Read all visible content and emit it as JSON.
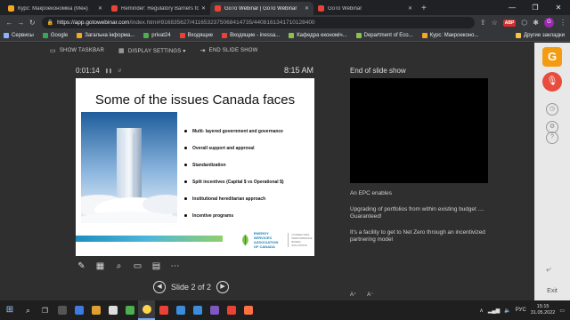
{
  "browser": {
    "tabs": [
      {
        "title": "Курс: Макроекономіка (Мен)",
        "color": "#f5a623",
        "active": false
      },
      {
        "title": "Reminder: Regulatory Barriers fo",
        "color": "#ea4335",
        "active": false
      },
      {
        "title": "GoTo Webinar | GoTo Webinar",
        "color": "#ea4335",
        "active": true
      },
      {
        "title": "GoTo Webinar",
        "color": "#ea4335",
        "active": false
      }
    ],
    "new_tab": "+",
    "url_main": "https://app.gotowebinar.com",
    "url_rest": "/index.html#916835627/4116532375068414735/4408161341710128400",
    "profile_initial": "G",
    "abp_label": "ABP"
  },
  "bookmarks": [
    {
      "label": "Сервисы",
      "color": "#8ab4f8"
    },
    {
      "label": "Google",
      "color": "#34a853"
    },
    {
      "label": "Загальна інформа...",
      "color": "#f5a623"
    },
    {
      "label": "privat24",
      "color": "#4caf50"
    },
    {
      "label": "Входящие",
      "color": "#ea4335"
    },
    {
      "label": "Входящие - inessa...",
      "color": "#ea4335"
    },
    {
      "label": "Кафедра економіч...",
      "color": "#8bc34a"
    },
    {
      "label": "Department of Eco...",
      "color": "#8bc34a"
    },
    {
      "label": "Курс: Макроеконо...",
      "color": "#f5a623"
    }
  ],
  "bookmarks_other": "Другие закладки",
  "webinar": {
    "controls": [
      "SHOW TASKBAR",
      "DISPLAY SETTINGS ▾",
      "END SLIDE SHOW"
    ],
    "elapsed": "0:01:14",
    "clock": "8:15 AM",
    "slide": {
      "title": "Some of the issues Canada faces",
      "bullets": [
        "Multi- layered government and governance",
        "Overall support and approval",
        "Standardization",
        "Split incentives (Capital $ vs Operational $)",
        "Institutional hereditarian approach",
        "Incentive programs"
      ],
      "logo_name": [
        "ENERGY SERVICES",
        "ASSOCIATION",
        "OF CANADA"
      ],
      "logo_sub": [
        "CONNECTING",
        "PERFORMANCE",
        "BASED SOLUTIONS"
      ]
    },
    "pager": "Slide 2 of 2",
    "next_title": "End of slide show",
    "notes": [
      "An EPC enables",
      "Upgrading of portfolios from within existing budget .... Guaranteed!",
      "It's a facility to get to Net Zero through an incentivized partnering model"
    ]
  },
  "sidebar": {
    "logo": "G",
    "exit_label": "Exit"
  },
  "taskbar": {
    "lang": "РУС",
    "time": "15:15",
    "date": "31.05.2022",
    "apps": [
      "#555555",
      "#3d7be0",
      "#e0a030",
      "#dddddd",
      "#4caf50",
      "#ffd54f",
      "#ea4335",
      "#3c8dde",
      "#3c8dde",
      "#7e57c2",
      "#ea4335",
      "#ff7043"
    ]
  }
}
